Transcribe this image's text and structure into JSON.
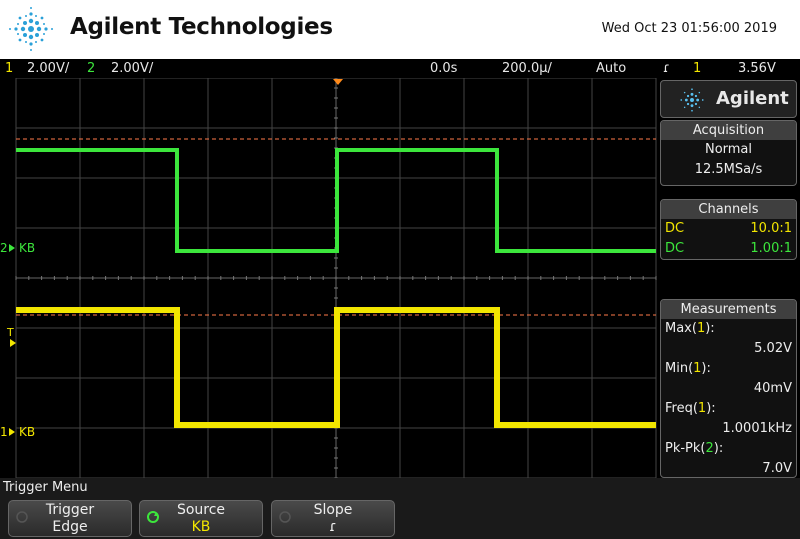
{
  "header": {
    "brand": "Agilent Technologies",
    "datetime": "Wed Oct 23 01:56:00 2019"
  },
  "status": {
    "ch1_num": "1",
    "ch1_scale": "2.00V/",
    "ch2_num": "2",
    "ch2_scale": "2.00V/",
    "time_offset": "0.0s",
    "time_scale": "200.0µ/",
    "mode": "Auto",
    "trigger_icon": "ɾ",
    "trigger_channel": "1",
    "trigger_level": "3.56V"
  },
  "display": {
    "ch2_marker_num": "2",
    "ch2_label": "KB",
    "ch1_marker_num": "1",
    "ch1_label": "KB",
    "trigger_marker": "T",
    "ch1_color": "#f2e600",
    "ch2_color": "#3ce63c"
  },
  "side": {
    "brand": "Agilent",
    "acquisition": {
      "title": "Acquisition",
      "mode": "Normal",
      "rate": "12.5MSa/s"
    },
    "channels": {
      "title": "Channels",
      "rows": [
        {
          "coupling": "DC",
          "ratio": "10.0:1"
        },
        {
          "coupling": "DC",
          "ratio": "1.00:1"
        }
      ]
    },
    "measurements": {
      "title": "Measurements",
      "items": [
        {
          "name": "Max(",
          "ch": "1",
          "close": "):",
          "value": "5.02V"
        },
        {
          "name": "Min(",
          "ch": "1",
          "close": "):",
          "value": "40mV"
        },
        {
          "name": "Freq(",
          "ch": "1",
          "close": "):",
          "value": "1.0001kHz"
        },
        {
          "name": "Pk-Pk(",
          "ch": "2",
          "close": "):",
          "value": "7.0V"
        }
      ]
    }
  },
  "footer": {
    "menu_title": "Trigger Menu",
    "keys": [
      {
        "top": "Trigger",
        "bottom": "Edge"
      },
      {
        "top": "Source",
        "bottom": "KB"
      },
      {
        "top": "Slope",
        "bottom": "ɾ"
      }
    ]
  }
}
